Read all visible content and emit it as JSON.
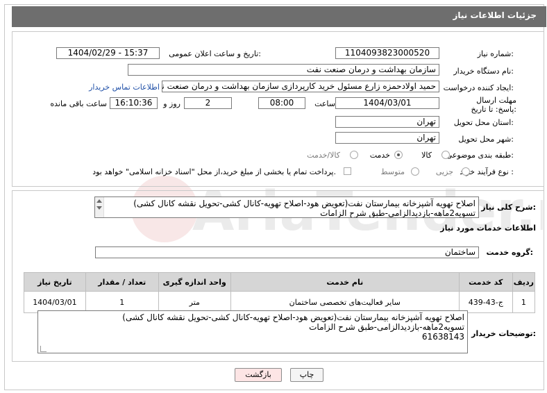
{
  "header": {
    "title": "جزئیات اطلاعات نیاز"
  },
  "form": {
    "need_number": {
      "label": "شماره نیاز:",
      "value": "1104093823000520"
    },
    "announce": {
      "label": "تاریخ و ساعت اعلان عمومی:",
      "value": "1404/02/29 - 15:37"
    },
    "buyer_org": {
      "label": "نام دستگاه خریدار:",
      "value": "سازمان بهداشت و درمان صنعت نفت"
    },
    "creator": {
      "label": "ایجاد کننده درخواست:",
      "value": "حمید اولادحمزه زارع مسئول خرید کارپردازی سازمان بهداشت و درمان صنعت نفت",
      "contact_link": "اطلاعات تماس خریدار"
    },
    "deadline": {
      "label": "مهلت ارسال پاسخ: تا تاریخ:",
      "date": "1404/03/01",
      "time_label": "ساعت",
      "time": "08:00",
      "days": "2",
      "days_label": "روز و",
      "remaining_time": "16:10:36",
      "remaining_label": "ساعت باقی مانده"
    },
    "province": {
      "label": "استان محل تحویل:",
      "value": "تهران"
    },
    "city": {
      "label": "شهر محل تحویل:",
      "value": "تهران"
    },
    "category": {
      "label": "طبقه بندی موضوعی:",
      "options": [
        "کالا",
        "خدمت",
        "کالا/خدمت"
      ],
      "selected": "خدمت"
    },
    "purchase_type": {
      "label": "نوع فرآیند خرید :",
      "options": [
        "جزیی",
        "متوسط"
      ],
      "note": "پرداخت تمام یا بخشی از مبلغ خرید،از محل \"اسناد خزانه اسلامی\" خواهد بود."
    }
  },
  "general_desc": {
    "label": "شرح کلی نیاز:",
    "line1": "اصلاح تهویه آشپزخانه بیمارستان نفت(تعویض هود-اصلاح تهویه-کانال کشی-تحویل نقشه کانال کشی)",
    "line2": "تسویه2ماهه-بازدیدالزامی-طبق شرح الزامات"
  },
  "services": {
    "title": "اطلاعات خدمات مورد نیاز",
    "group_label": "گروه خدمت:",
    "group_value": "ساختمان",
    "columns": [
      "ردیف",
      "کد خدمت",
      "نام خدمت",
      "واحد اندازه گیری",
      "تعداد / مقدار",
      "تاریخ نیاز"
    ],
    "rows": [
      [
        "1",
        "ج-43-439",
        "سایر فعالیت‌های تخصصی ساختمان",
        "متر",
        "1",
        "1404/03/01"
      ]
    ]
  },
  "buyer_notes": {
    "label": "توضیحات خریدار:",
    "line1": "اصلاح تهویه آشپزخانه بیمارستان نفت(تعویض هود-اصلاح تهویه-کانال کشی-تحویل نقشه کانال کشی)",
    "line2": "تسویه2ماهه-بازدیدالزامی-طبق شرح الزامات",
    "line3": "61638143"
  },
  "buttons": {
    "print": "چاپ",
    "back": "بازگشت"
  },
  "colors": {
    "header_bg": "#6e6e6e",
    "table_header_bg": "#d6d6d6",
    "back_button_bg": "#fde5e5",
    "link": "#1f4fa7"
  }
}
